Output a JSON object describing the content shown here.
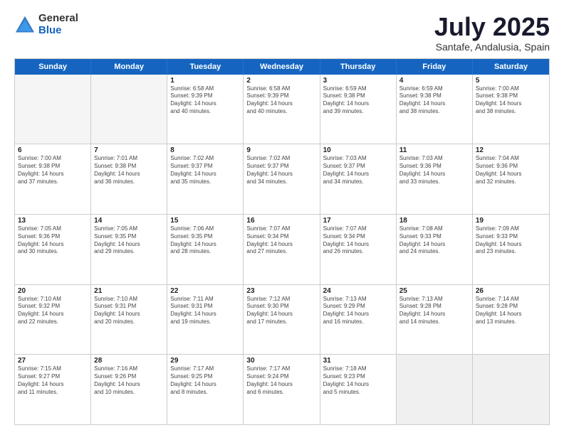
{
  "logo": {
    "general": "General",
    "blue": "Blue"
  },
  "header": {
    "month": "July 2025",
    "location": "Santafe, Andalusia, Spain"
  },
  "weekdays": [
    "Sunday",
    "Monday",
    "Tuesday",
    "Wednesday",
    "Thursday",
    "Friday",
    "Saturday"
  ],
  "weeks": [
    [
      {
        "day": "",
        "empty": true,
        "lines": []
      },
      {
        "day": "",
        "empty": true,
        "lines": []
      },
      {
        "day": "1",
        "lines": [
          "Sunrise: 6:58 AM",
          "Sunset: 9:39 PM",
          "Daylight: 14 hours",
          "and 40 minutes."
        ]
      },
      {
        "day": "2",
        "lines": [
          "Sunrise: 6:58 AM",
          "Sunset: 9:39 PM",
          "Daylight: 14 hours",
          "and 40 minutes."
        ]
      },
      {
        "day": "3",
        "lines": [
          "Sunrise: 6:59 AM",
          "Sunset: 9:38 PM",
          "Daylight: 14 hours",
          "and 39 minutes."
        ]
      },
      {
        "day": "4",
        "lines": [
          "Sunrise: 6:59 AM",
          "Sunset: 9:38 PM",
          "Daylight: 14 hours",
          "and 38 minutes."
        ]
      },
      {
        "day": "5",
        "lines": [
          "Sunrise: 7:00 AM",
          "Sunset: 9:38 PM",
          "Daylight: 14 hours",
          "and 38 minutes."
        ]
      }
    ],
    [
      {
        "day": "6",
        "lines": [
          "Sunrise: 7:00 AM",
          "Sunset: 9:38 PM",
          "Daylight: 14 hours",
          "and 37 minutes."
        ]
      },
      {
        "day": "7",
        "lines": [
          "Sunrise: 7:01 AM",
          "Sunset: 9:38 PM",
          "Daylight: 14 hours",
          "and 36 minutes."
        ]
      },
      {
        "day": "8",
        "lines": [
          "Sunrise: 7:02 AM",
          "Sunset: 9:37 PM",
          "Daylight: 14 hours",
          "and 35 minutes."
        ]
      },
      {
        "day": "9",
        "lines": [
          "Sunrise: 7:02 AM",
          "Sunset: 9:37 PM",
          "Daylight: 14 hours",
          "and 34 minutes."
        ]
      },
      {
        "day": "10",
        "lines": [
          "Sunrise: 7:03 AM",
          "Sunset: 9:37 PM",
          "Daylight: 14 hours",
          "and 34 minutes."
        ]
      },
      {
        "day": "11",
        "lines": [
          "Sunrise: 7:03 AM",
          "Sunset: 9:36 PM",
          "Daylight: 14 hours",
          "and 33 minutes."
        ]
      },
      {
        "day": "12",
        "lines": [
          "Sunrise: 7:04 AM",
          "Sunset: 9:36 PM",
          "Daylight: 14 hours",
          "and 32 minutes."
        ]
      }
    ],
    [
      {
        "day": "13",
        "lines": [
          "Sunrise: 7:05 AM",
          "Sunset: 9:36 PM",
          "Daylight: 14 hours",
          "and 30 minutes."
        ]
      },
      {
        "day": "14",
        "lines": [
          "Sunrise: 7:05 AM",
          "Sunset: 9:35 PM",
          "Daylight: 14 hours",
          "and 29 minutes."
        ]
      },
      {
        "day": "15",
        "lines": [
          "Sunrise: 7:06 AM",
          "Sunset: 9:35 PM",
          "Daylight: 14 hours",
          "and 28 minutes."
        ]
      },
      {
        "day": "16",
        "lines": [
          "Sunrise: 7:07 AM",
          "Sunset: 9:34 PM",
          "Daylight: 14 hours",
          "and 27 minutes."
        ]
      },
      {
        "day": "17",
        "lines": [
          "Sunrise: 7:07 AM",
          "Sunset: 9:34 PM",
          "Daylight: 14 hours",
          "and 26 minutes."
        ]
      },
      {
        "day": "18",
        "lines": [
          "Sunrise: 7:08 AM",
          "Sunset: 9:33 PM",
          "Daylight: 14 hours",
          "and 24 minutes."
        ]
      },
      {
        "day": "19",
        "lines": [
          "Sunrise: 7:09 AM",
          "Sunset: 9:33 PM",
          "Daylight: 14 hours",
          "and 23 minutes."
        ]
      }
    ],
    [
      {
        "day": "20",
        "lines": [
          "Sunrise: 7:10 AM",
          "Sunset: 9:32 PM",
          "Daylight: 14 hours",
          "and 22 minutes."
        ]
      },
      {
        "day": "21",
        "lines": [
          "Sunrise: 7:10 AM",
          "Sunset: 9:31 PM",
          "Daylight: 14 hours",
          "and 20 minutes."
        ]
      },
      {
        "day": "22",
        "lines": [
          "Sunrise: 7:11 AM",
          "Sunset: 9:31 PM",
          "Daylight: 14 hours",
          "and 19 minutes."
        ]
      },
      {
        "day": "23",
        "lines": [
          "Sunrise: 7:12 AM",
          "Sunset: 9:30 PM",
          "Daylight: 14 hours",
          "and 17 minutes."
        ]
      },
      {
        "day": "24",
        "lines": [
          "Sunrise: 7:13 AM",
          "Sunset: 9:29 PM",
          "Daylight: 14 hours",
          "and 16 minutes."
        ]
      },
      {
        "day": "25",
        "lines": [
          "Sunrise: 7:13 AM",
          "Sunset: 9:28 PM",
          "Daylight: 14 hours",
          "and 14 minutes."
        ]
      },
      {
        "day": "26",
        "lines": [
          "Sunrise: 7:14 AM",
          "Sunset: 9:28 PM",
          "Daylight: 14 hours",
          "and 13 minutes."
        ]
      }
    ],
    [
      {
        "day": "27",
        "lines": [
          "Sunrise: 7:15 AM",
          "Sunset: 9:27 PM",
          "Daylight: 14 hours",
          "and 11 minutes."
        ]
      },
      {
        "day": "28",
        "lines": [
          "Sunrise: 7:16 AM",
          "Sunset: 9:26 PM",
          "Daylight: 14 hours",
          "and 10 minutes."
        ]
      },
      {
        "day": "29",
        "lines": [
          "Sunrise: 7:17 AM",
          "Sunset: 9:25 PM",
          "Daylight: 14 hours",
          "and 8 minutes."
        ]
      },
      {
        "day": "30",
        "lines": [
          "Sunrise: 7:17 AM",
          "Sunset: 9:24 PM",
          "Daylight: 14 hours",
          "and 6 minutes."
        ]
      },
      {
        "day": "31",
        "lines": [
          "Sunrise: 7:18 AM",
          "Sunset: 9:23 PM",
          "Daylight: 14 hours",
          "and 5 minutes."
        ]
      },
      {
        "day": "",
        "empty": true,
        "shaded": true,
        "lines": []
      },
      {
        "day": "",
        "empty": true,
        "shaded": true,
        "lines": []
      }
    ]
  ]
}
